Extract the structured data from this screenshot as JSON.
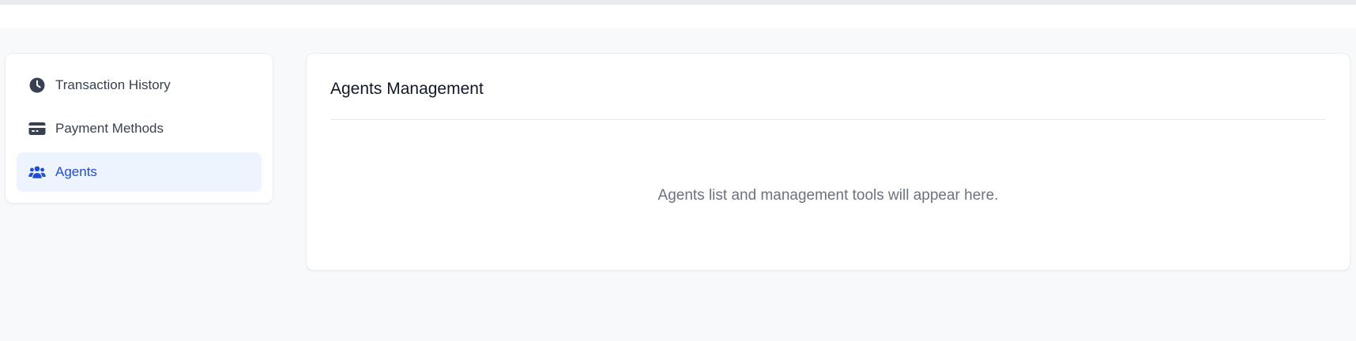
{
  "sidebar": {
    "items": [
      {
        "label": "Transaction History",
        "icon": "clock-icon",
        "active": false
      },
      {
        "label": "Payment Methods",
        "icon": "credit-card-icon",
        "active": false
      },
      {
        "label": "Agents",
        "icon": "users-icon",
        "active": true
      }
    ]
  },
  "main": {
    "title": "Agents Management",
    "empty_message": "Agents list and management tools will appear here."
  },
  "colors": {
    "page_background": "#f8f9fb",
    "card_background": "#ffffff",
    "active_item_background": "#eef4fe",
    "active_accent": "#1d4ed8",
    "inactive_icon": "#374151",
    "muted_text": "#6b7280"
  }
}
